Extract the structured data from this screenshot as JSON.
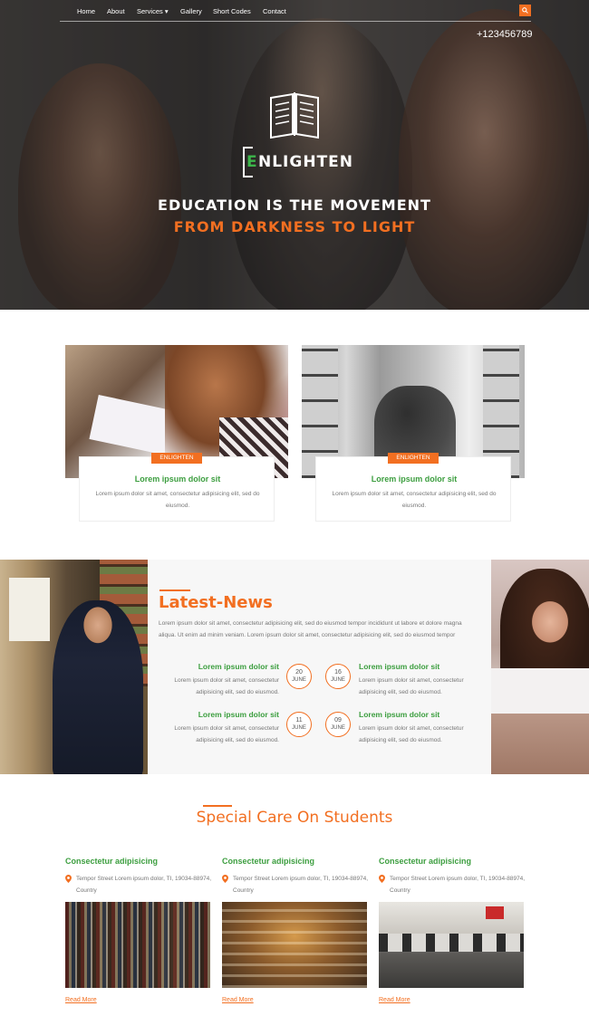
{
  "nav": {
    "items": [
      "Home",
      "About",
      "Services",
      "Gallery",
      "Short Codes",
      "Contact"
    ],
    "services_caret": "▾",
    "search_icon": "search-icon"
  },
  "hero": {
    "phone": "+123456789",
    "logo_letter": "E",
    "logo_rest": "NLIGHTEN",
    "tagline_line1": "EDUCATION IS THE MOVEMENT",
    "tagline_line2": "FROM DARKNESS TO LIGHT",
    "book_icon": "open-book-icon"
  },
  "features": [
    {
      "tag": "ENLIGHTEN",
      "title": "Lorem ipsum dolor sit",
      "text": "Lorem ipsum dolor sit amet, consectetur adipisicing elit, sed do eiusmod."
    },
    {
      "tag": "ENLIGHTEN",
      "title": "Lorem ipsum dolor sit",
      "text": "Lorem ipsum dolor sit amet, consectetur adipisicing elit, sed do eiusmod."
    }
  ],
  "news": {
    "title": "Latest-News",
    "intro": "Lorem ipsum dolor sit amet, consectetur adipisicing elit, sed do eiusmod tempor incididunt ut labore et dolore magna aliqua. Ut enim ad minim veniam. Lorem ipsum dolor sit amet, consectetur adipisicing elit, sed do eiusmod tempor",
    "items": [
      {
        "title": "Lorem ipsum dolor sit",
        "text": "Lorem ipsum dolor sit amet, consectetur adipisicing elit, sed do eiusmod.",
        "day": "20",
        "month": "JUNE"
      },
      {
        "title": "Lorem ipsum dolor sit",
        "text": "Lorem ipsum dolor sit amet, consectetur adipisicing elit, sed do eiusmod.",
        "day": "16",
        "month": "JUNE"
      },
      {
        "title": "Lorem ipsum dolor sit",
        "text": "Lorem ipsum dolor sit amet, consectetur adipisicing elit, sed do eiusmod.",
        "day": "11",
        "month": "JUNE"
      },
      {
        "title": "Lorem ipsum dolor sit",
        "text": "Lorem ipsum dolor sit amet, consectetur adipisicing elit, sed do eiusmod.",
        "day": "09",
        "month": "JUNE"
      }
    ]
  },
  "special": {
    "title": "Special Care On Students",
    "columns": [
      {
        "title": "Consectetur adipisicing",
        "address": "Tempor Street Lorem ipsum dolor, TI, 19034-88974, Country",
        "link": "Read More"
      },
      {
        "title": "Consectetur adipisicing",
        "address": "Tempor Street Lorem ipsum dolor, TI, 19034-88974, Country",
        "link": "Read More"
      },
      {
        "title": "Consectetur adipisicing",
        "address": "Tempor Street Lorem ipsum dolor, TI, 19034-88974, Country",
        "link": "Read More"
      }
    ],
    "pin_icon": "map-pin-icon"
  },
  "colors": {
    "accent": "#f26f21",
    "green": "#3c9e3f",
    "logo_green": "#3cb54a"
  }
}
